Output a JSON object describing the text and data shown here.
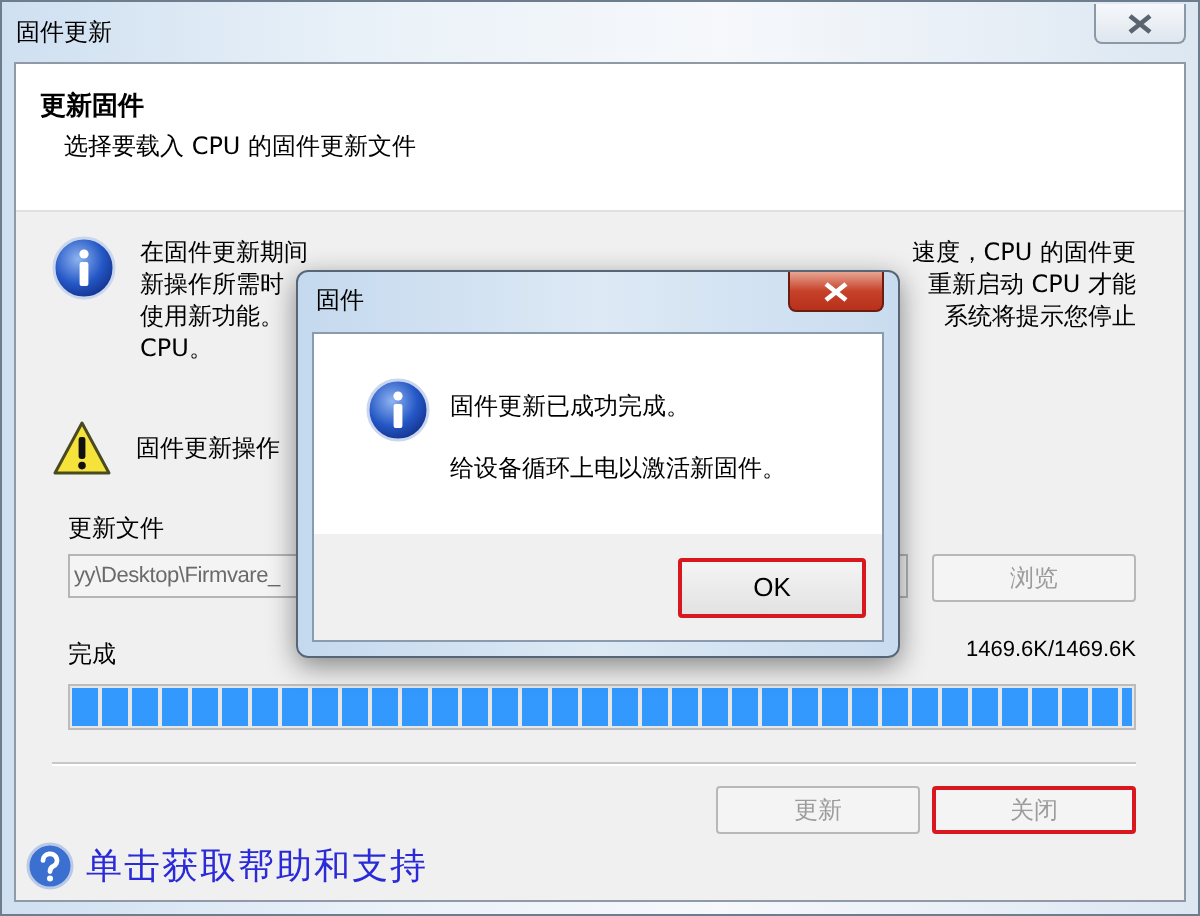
{
  "window": {
    "title": "固件更新"
  },
  "header": {
    "title": "更新固件",
    "subtitle": "选择要载入 CPU 的固件更新文件"
  },
  "info": {
    "lines": [
      {
        "left": "在固件更新期间",
        "right": "速度，CPU 的固件更"
      },
      {
        "left": "新操作所需时",
        "right": "重新启动 CPU 才能"
      },
      {
        "left": "使用新功能。",
        "right": "系统将提示您停止"
      },
      {
        "left": "CPU。"
      }
    ]
  },
  "warning": {
    "text": "固件更新操作"
  },
  "file": {
    "label": "更新文件",
    "value": "yy\\Desktop\\Firmvare_",
    "disabled": true,
    "browse": {
      "label": "浏览",
      "disabled": true
    }
  },
  "progress": {
    "label": "完成",
    "reading": "1469.6K/1469.6K",
    "level": 1
  },
  "buttons": [
    {
      "label": "更新",
      "disabled": true,
      "highlighted": false
    },
    {
      "label": "关闭",
      "disabled": true,
      "highlighted": true
    }
  ],
  "help_link": "单击获取帮助和支持",
  "dialog": {
    "title": "固件",
    "lines": [
      "固件更新已成功完成。",
      "给设备循环上电以激活新固件。"
    ],
    "button": {
      "label": "OK",
      "highlighted": true
    }
  }
}
